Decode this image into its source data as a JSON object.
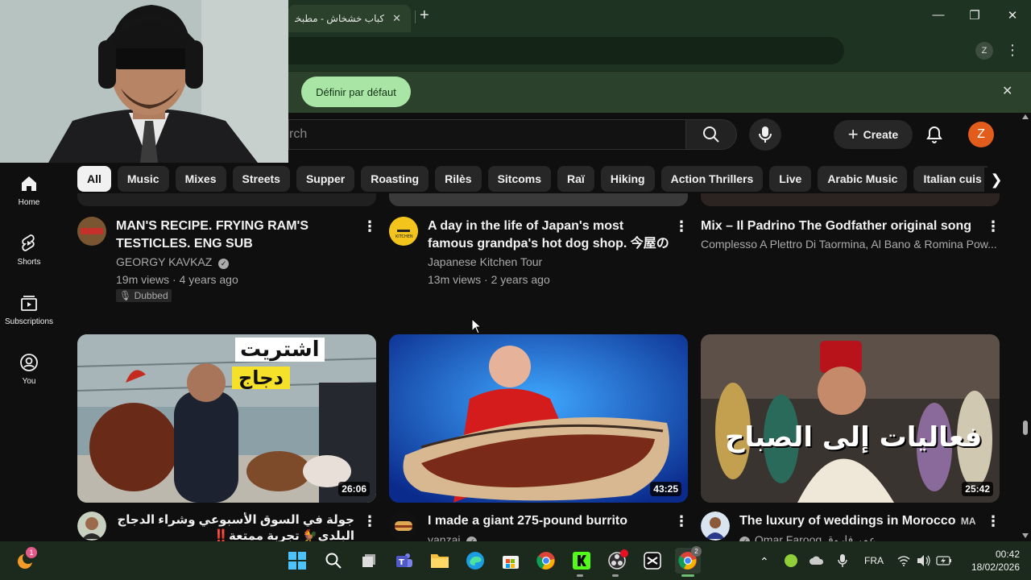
{
  "browser": {
    "tab_title": "كباب خشخاش - مطبخنا",
    "tab_close": "✕",
    "new_tab": "+",
    "infobar_button": "Définir par défaut",
    "infobar_close": "✕",
    "profile_initial": "Z"
  },
  "youtube": {
    "search_placeholder": "rch",
    "create_label": "Create",
    "avatar_initial": "Z",
    "sidebar": [
      {
        "label": "Home",
        "icon": "home-icon"
      },
      {
        "label": "Shorts",
        "icon": "shorts-icon"
      },
      {
        "label": "Subscriptions",
        "icon": "subscriptions-icon"
      },
      {
        "label": "You",
        "icon": "you-icon"
      }
    ],
    "chips": [
      "All",
      "Music",
      "Mixes",
      "Streets",
      "Supper",
      "Roasting",
      "Rilès",
      "Sitcoms",
      "Raï",
      "Hiking",
      "Action Thrillers",
      "Live",
      "Arabic Music",
      "Italian cuis"
    ],
    "row1": [
      {
        "title": "MAN'S RECIPE. FRYING RAM'S TESTICLES. ENG SUB",
        "channel": "GEORGY KAVKAZ",
        "stats": "19m views · 4 years ago",
        "badge": "Dubbed",
        "avatar_text": "GEORGY KAVKAZ"
      },
      {
        "title": "A day in the life of Japan's most famous grandpa's hot dog shop. 今屋のハンバー...",
        "channel": "Japanese Kitchen Tour",
        "stats": "13m views · 2 years ago",
        "avatar_text": "KITCHEN"
      },
      {
        "title": "Mix – Il Padrino  The Godfather original song",
        "channel": "Complesso A Plettro Di Taormina, Al Bano & Romina Pow..."
      }
    ],
    "row2": [
      {
        "title": "جولة في السوق الأسبوعي وشراء الدجاج البلدي🐓 تجربة ممتعة‼️",
        "channel": "",
        "duration": "26:06",
        "thumb_text_1": "اشتريت",
        "thumb_text_2": "دجاج"
      },
      {
        "title": "I made a giant 275-pound burrito",
        "channel": "yanzai",
        "duration": "43:25"
      },
      {
        "title": "The luxury of weddings in Morocco",
        "title_suffix": "MA",
        "channel": "Omar Farooq عمر فاروق",
        "duration": "25:42",
        "thumb_text": "فعاليات إلى الصباح"
      }
    ]
  },
  "taskbar": {
    "language": "FRA",
    "time": "00:42",
    "date": "18/02/2026",
    "notif_count": "1",
    "chrome_badge": "2"
  }
}
